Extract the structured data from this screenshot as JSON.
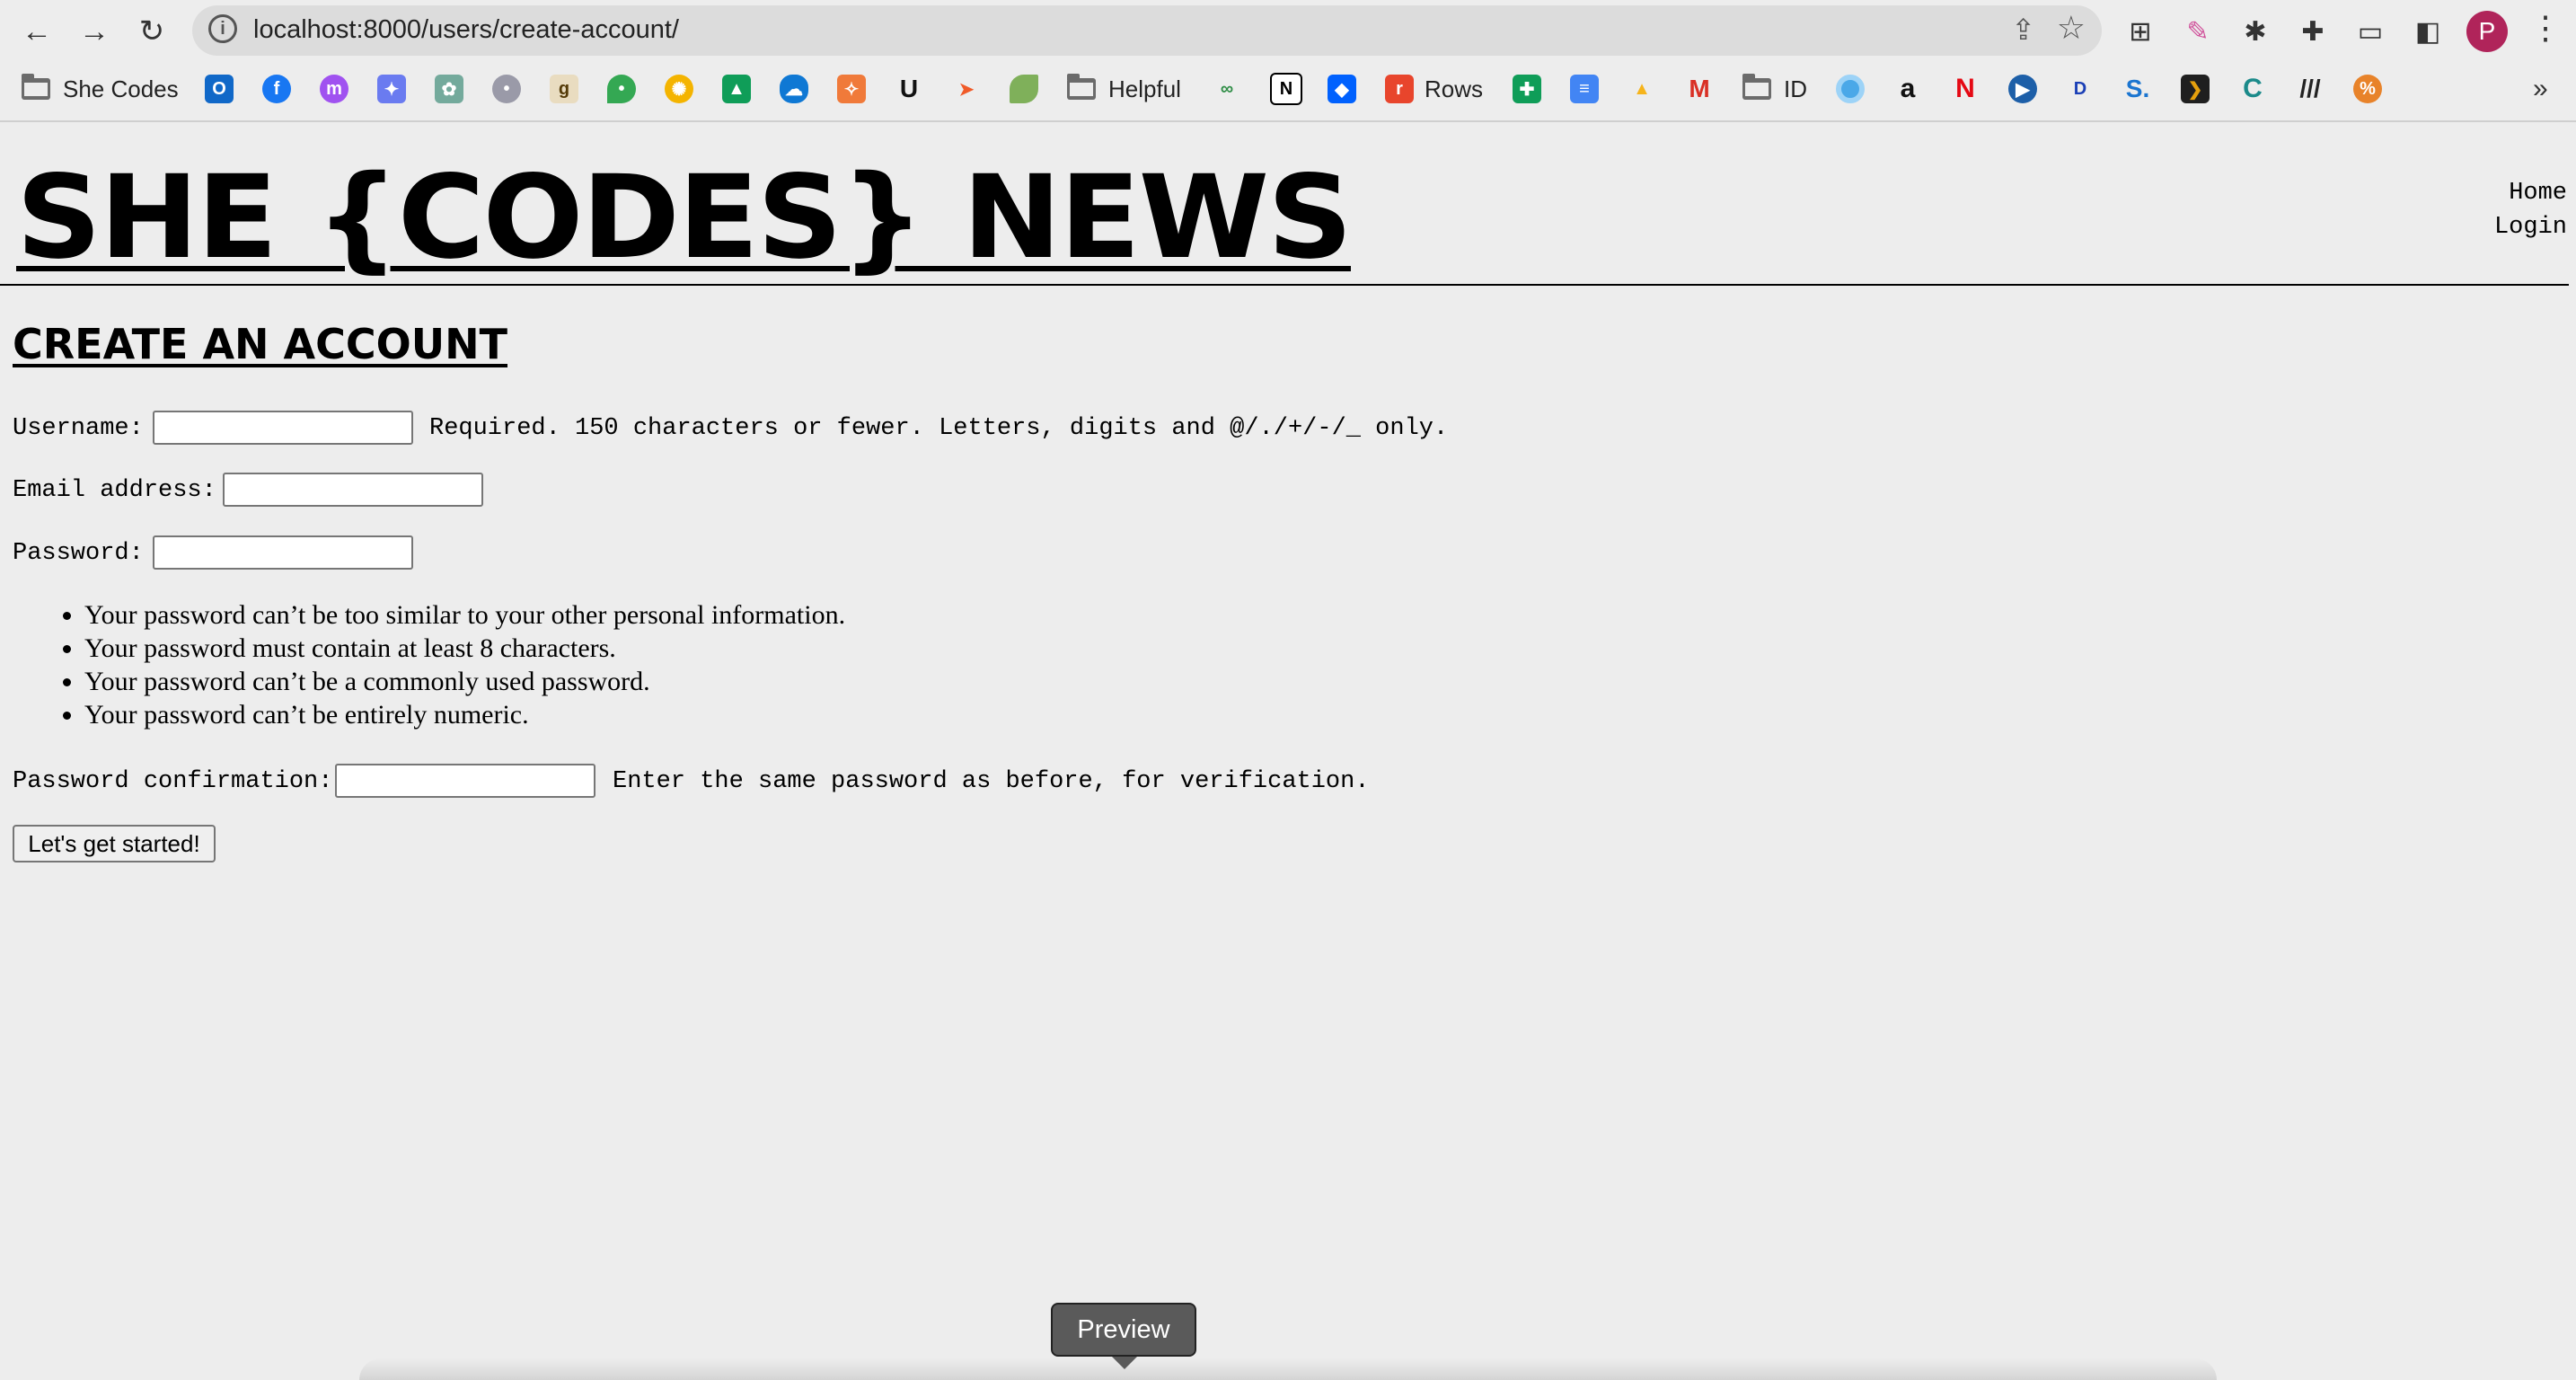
{
  "browser": {
    "url": "localhost:8000/users/create-account/",
    "profile_initial": "P",
    "bookmarks": [
      {
        "label": "She Codes",
        "type": "folder"
      },
      {
        "label": "Helpful",
        "type": "folder"
      },
      {
        "label": "Rows",
        "type": "site"
      },
      {
        "label": "ID",
        "type": "folder"
      }
    ]
  },
  "site": {
    "title": "SHE {CODES} NEWS",
    "nav": [
      "Home",
      "Login"
    ]
  },
  "form": {
    "heading": "CREATE AN ACCOUNT",
    "username_label": "Username:",
    "username_help": "Required. 150 characters or fewer. Letters, digits and @/./+/-/_ only.",
    "email_label": "Email address:",
    "password_label": "Password:",
    "password_rules": [
      "Your password can’t be too similar to your other personal information.",
      "Your password must contain at least 8 characters.",
      "Your password can’t be a commonly used password.",
      "Your password can’t be entirely numeric."
    ],
    "confirm_label": "Password confirmation:",
    "confirm_help": "Enter the same password as before, for verification.",
    "submit": "Let's get started!"
  },
  "tooltip": "Preview"
}
